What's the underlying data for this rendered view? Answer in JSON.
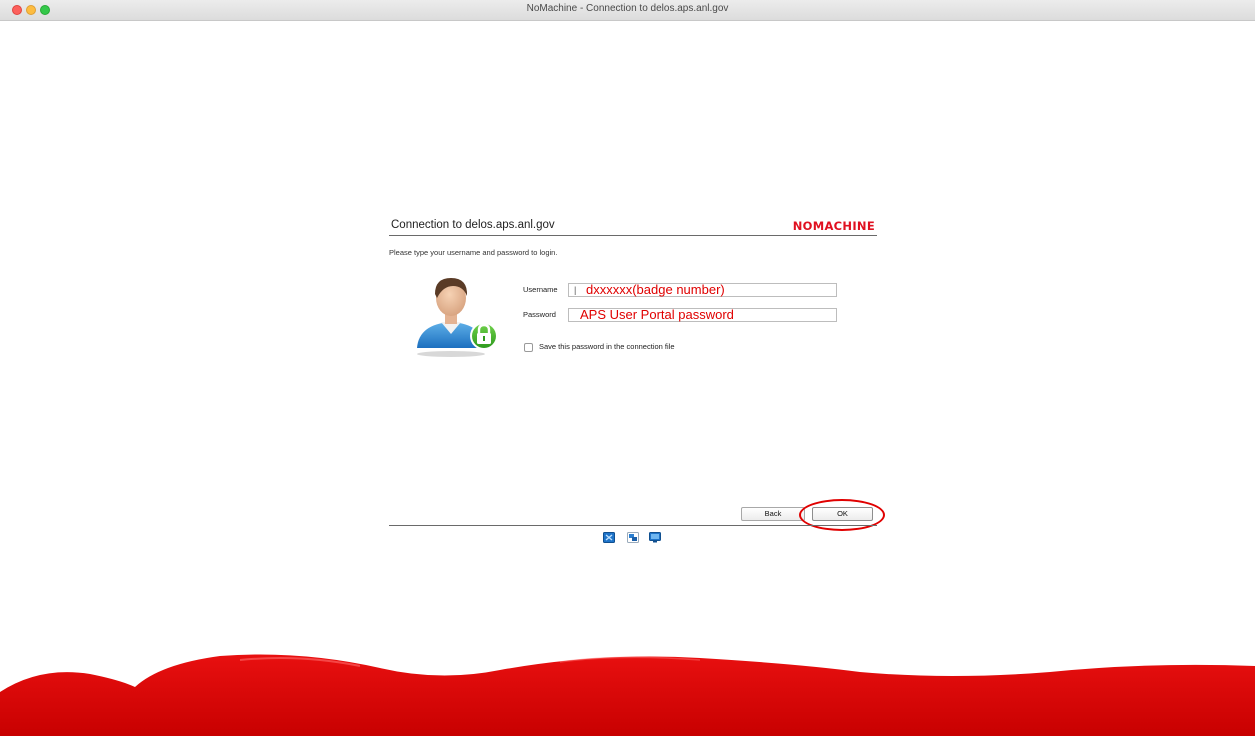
{
  "window": {
    "title": "NoMachine - Connection to delos.aps.anl.gov"
  },
  "panel": {
    "title": "Connection to delos.aps.anl.gov",
    "logo_text": "NOMACHINE",
    "instructions": "Please type your username and password to login."
  },
  "form": {
    "username_label": "Username",
    "username_value": "dxxxxxx(badge number)",
    "password_label": "Password",
    "password_value": "APS User Portal password",
    "save_password_label": "Save this password in the connection file",
    "save_password_checked": false
  },
  "buttons": {
    "back_label": "Back",
    "ok_label": "OK"
  },
  "icons": {
    "avatar": "user-avatar-icon",
    "lock": "lock-icon",
    "toolbar": [
      "settings-icon",
      "display-icon",
      "monitor-icon"
    ]
  },
  "colors": {
    "brand_red": "#e01020",
    "annotation_red": "#e00000",
    "lock_green": "#43b02a",
    "wave_red": "#d40000"
  }
}
